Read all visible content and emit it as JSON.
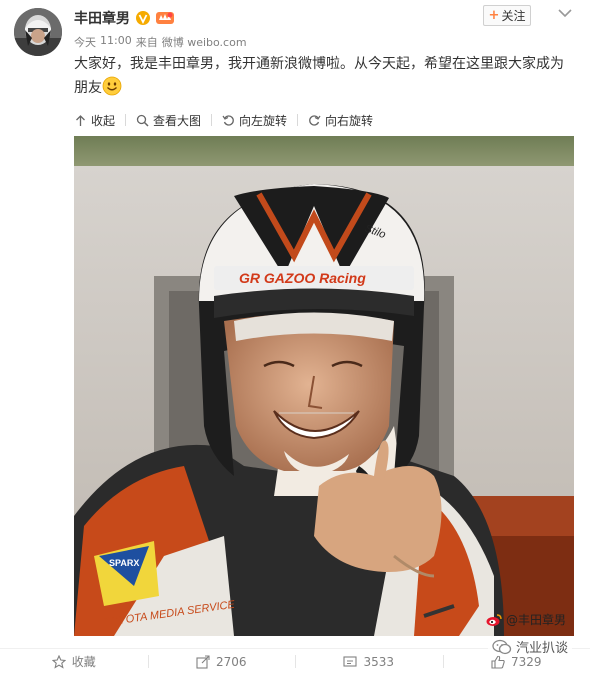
{
  "author": {
    "name": "丰田章男",
    "follow_label": "关注",
    "follow_plus": "+"
  },
  "meta": {
    "day": "今天",
    "time": "11:00",
    "source_prefix": "来自",
    "source": "微博 weibo.com"
  },
  "post": {
    "text": "大家好，我是丰田章男，我开通新浪微博啦。从今天起，希望在这里跟大家成为朋友"
  },
  "image_toolbar": {
    "collapse": "收起",
    "view_large": "查看大图",
    "rotate_left": "向左旋转",
    "rotate_right": "向右旋转"
  },
  "photo": {
    "helmet_text": "GR GAZOO Racing",
    "helmet_brand": "Stilo",
    "patch_text": "SPARX",
    "suit_text": "TOYOTA MEDIA SERVICE",
    "watermark": "@丰田章男"
  },
  "actions": {
    "favorite": "收藏",
    "repost": "2706",
    "comment": "3533",
    "like": "7329"
  },
  "footer_watermark": "汽业扒谈",
  "colors": {
    "accent": "#ff8140",
    "vip_gold": "#f6ab00",
    "text_gray": "#808080"
  }
}
